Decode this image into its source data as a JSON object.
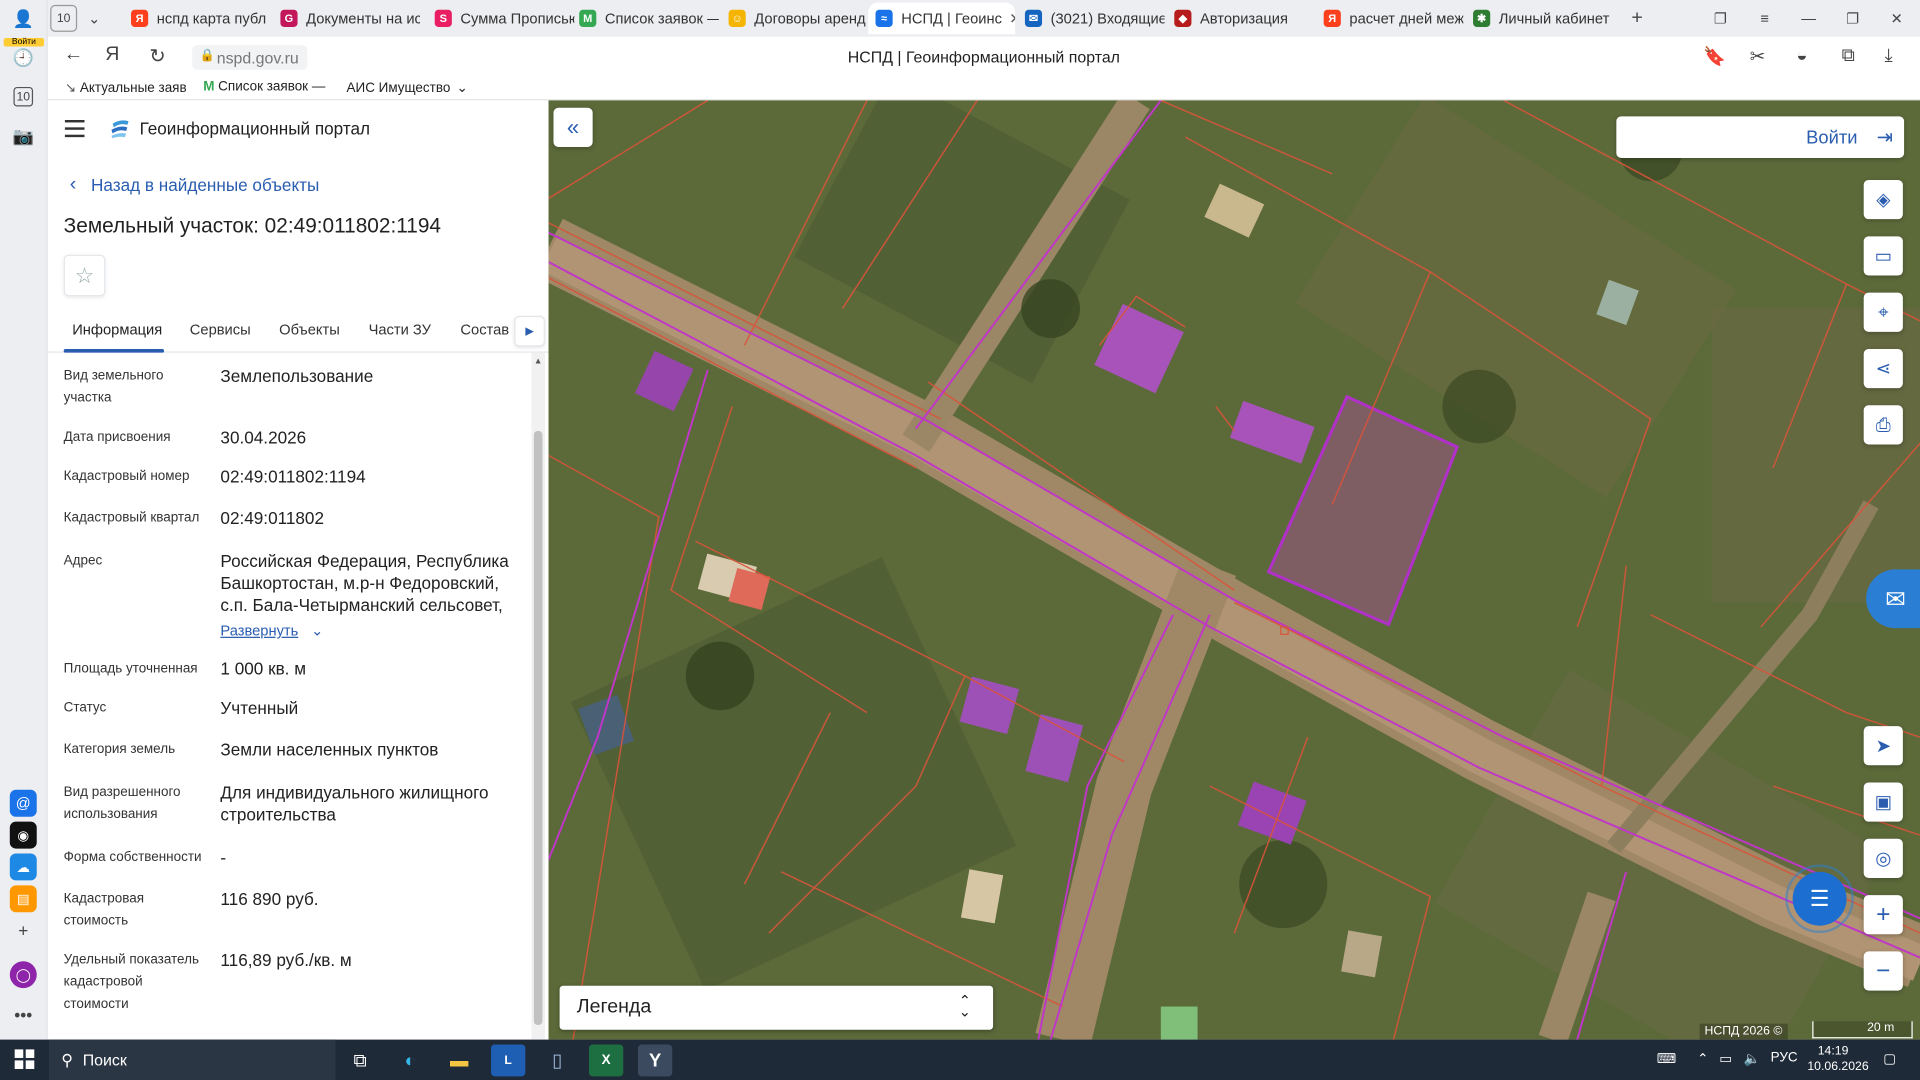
{
  "browser": {
    "tab_count": "10",
    "login_label": "Войти",
    "tabs": [
      {
        "title": "нспд карта публ",
        "fav": "Я",
        "color": "#fc3f1d"
      },
      {
        "title": "Документы на ис",
        "fav": "G",
        "color": "#c2185b"
      },
      {
        "title": "Сумма Прописью",
        "fav": "S",
        "color": "#e91e63"
      },
      {
        "title": "Список заявок —",
        "fav": "M",
        "color": "#34a853"
      },
      {
        "title": "Договоры аренд",
        "fav": "☺",
        "color": "#f4b400"
      },
      {
        "title": "НСПД | Геоинс",
        "fav": "≈",
        "color": "#1a73e8",
        "active": true
      },
      {
        "title": "(3021) Входящие",
        "fav": "✉",
        "color": "#1565c0"
      },
      {
        "title": "Авторизация",
        "fav": "◆",
        "color": "#b71c1c"
      },
      {
        "title": "расчет дней меж",
        "fav": "Я",
        "color": "#fc3f1d"
      },
      {
        "title": "Личный кабинет",
        "fav": "✱",
        "color": "#2e7d32"
      }
    ],
    "url": "nspd.gov.ru",
    "page_title": "НСПД | Геоинформационный портал",
    "bookmarks": [
      "Актуальные заяв",
      "Список заявок —",
      "АИС Имущество"
    ]
  },
  "panel": {
    "portal_name": "Геоинформационный портал",
    "back_label": "Назад в найденные объекты",
    "title": "Земельный участок: 02:49:011802:1194",
    "tabs": [
      "Информация",
      "Сервисы",
      "Объекты",
      "Части ЗУ",
      "Состав"
    ],
    "expand_label": "Развернуть",
    "rows": [
      {
        "key": "Вид земельного участка",
        "value": "Землепользование"
      },
      {
        "key": "Дата присвоения",
        "value": "30.04.2026"
      },
      {
        "key": "Кадастровый номер",
        "value": "02:49:011802:1194"
      },
      {
        "key": "Кадастровый квартал",
        "value": "02:49:011802"
      },
      {
        "key": "Адрес",
        "value": "Российская Федерация, Республика Башкортостан, м.р-н Федоровский, с.п. Бала-Четырманский сельсовет,"
      },
      {
        "key": "Площадь уточненная",
        "value": "1 000 кв. м"
      },
      {
        "key": "Статус",
        "value": "Учтенный"
      },
      {
        "key": "Категория земель",
        "value": "Земли населенных пунктов"
      },
      {
        "key": "Вид разрешенного использования",
        "value": "Для индивидуального жилищного строительства"
      },
      {
        "key": "Форма собственности",
        "value": "-"
      },
      {
        "key": "Кадастровая стоимость",
        "value": "116 890 руб."
      },
      {
        "key": "Удельный показатель кадастровой стоимости",
        "value": "116,89 руб./кв. м"
      }
    ]
  },
  "map": {
    "login_label": "Войти",
    "legend_label": "Легенда",
    "copyright": "НСПД 2026 ©",
    "scale_label": "20 m"
  },
  "taskbar": {
    "search_label": "Поиск",
    "lang": "РУС",
    "time": "14:19",
    "date": "10.06.2026"
  }
}
